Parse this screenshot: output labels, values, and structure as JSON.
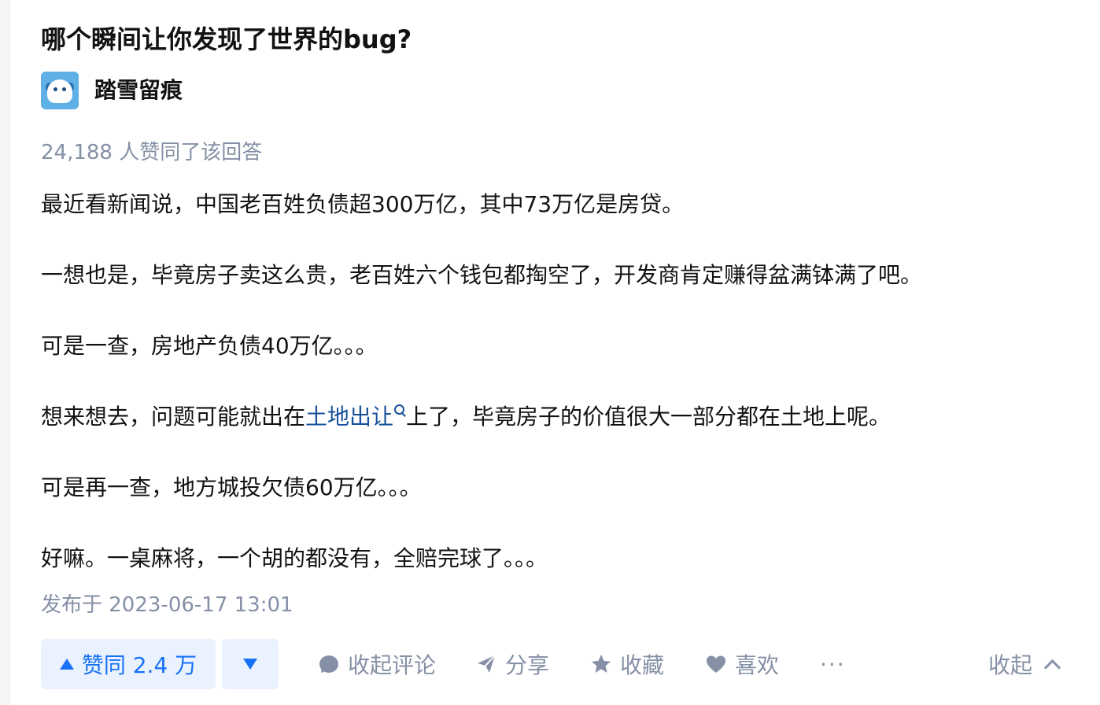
{
  "question": {
    "title": "哪个瞬间让你发现了世界的bug?"
  },
  "author": {
    "name": "踏雪留痕",
    "avatar_icon": "polar-bear-avatar"
  },
  "answer": {
    "vote_summary": "24,188 人赞同了该回答",
    "paragraphs": [
      "最近看新闻说，中国老百姓负债超300万亿，其中73万亿是房贷。",
      "一想也是，毕竟房子卖这么贵，老百姓六个钱包都掏空了，开发商肯定赚得盆满钵满了吧。",
      "可是一查，房地产负债40万亿。。。",
      {
        "before": "想来想去，问题可能就出在",
        "link": "土地出让",
        "after": "上了，毕竟房子的价值很大一部分都在土地上呢。"
      },
      "可是再一查，地方城投欠债60万亿。。。",
      "好嘛。一桌麻将，一个胡的都没有，全赔完球了。。。"
    ],
    "publish_time": "发布于 2023-06-17 13:01"
  },
  "actions": {
    "vote_up_label": "赞同 2.4 万",
    "vote_down_icon": "triangle-down-icon",
    "comment_label": "收起评论",
    "share_label": "分享",
    "favorite_label": "收藏",
    "like_label": "喜欢",
    "more_label": "···",
    "collapse_label": "收起"
  },
  "colors": {
    "primary_blue": "#1772f6",
    "link_blue": "#175199",
    "muted_gray": "#8590a6",
    "text": "#121212",
    "vote_bg": "#eaf2ff"
  }
}
